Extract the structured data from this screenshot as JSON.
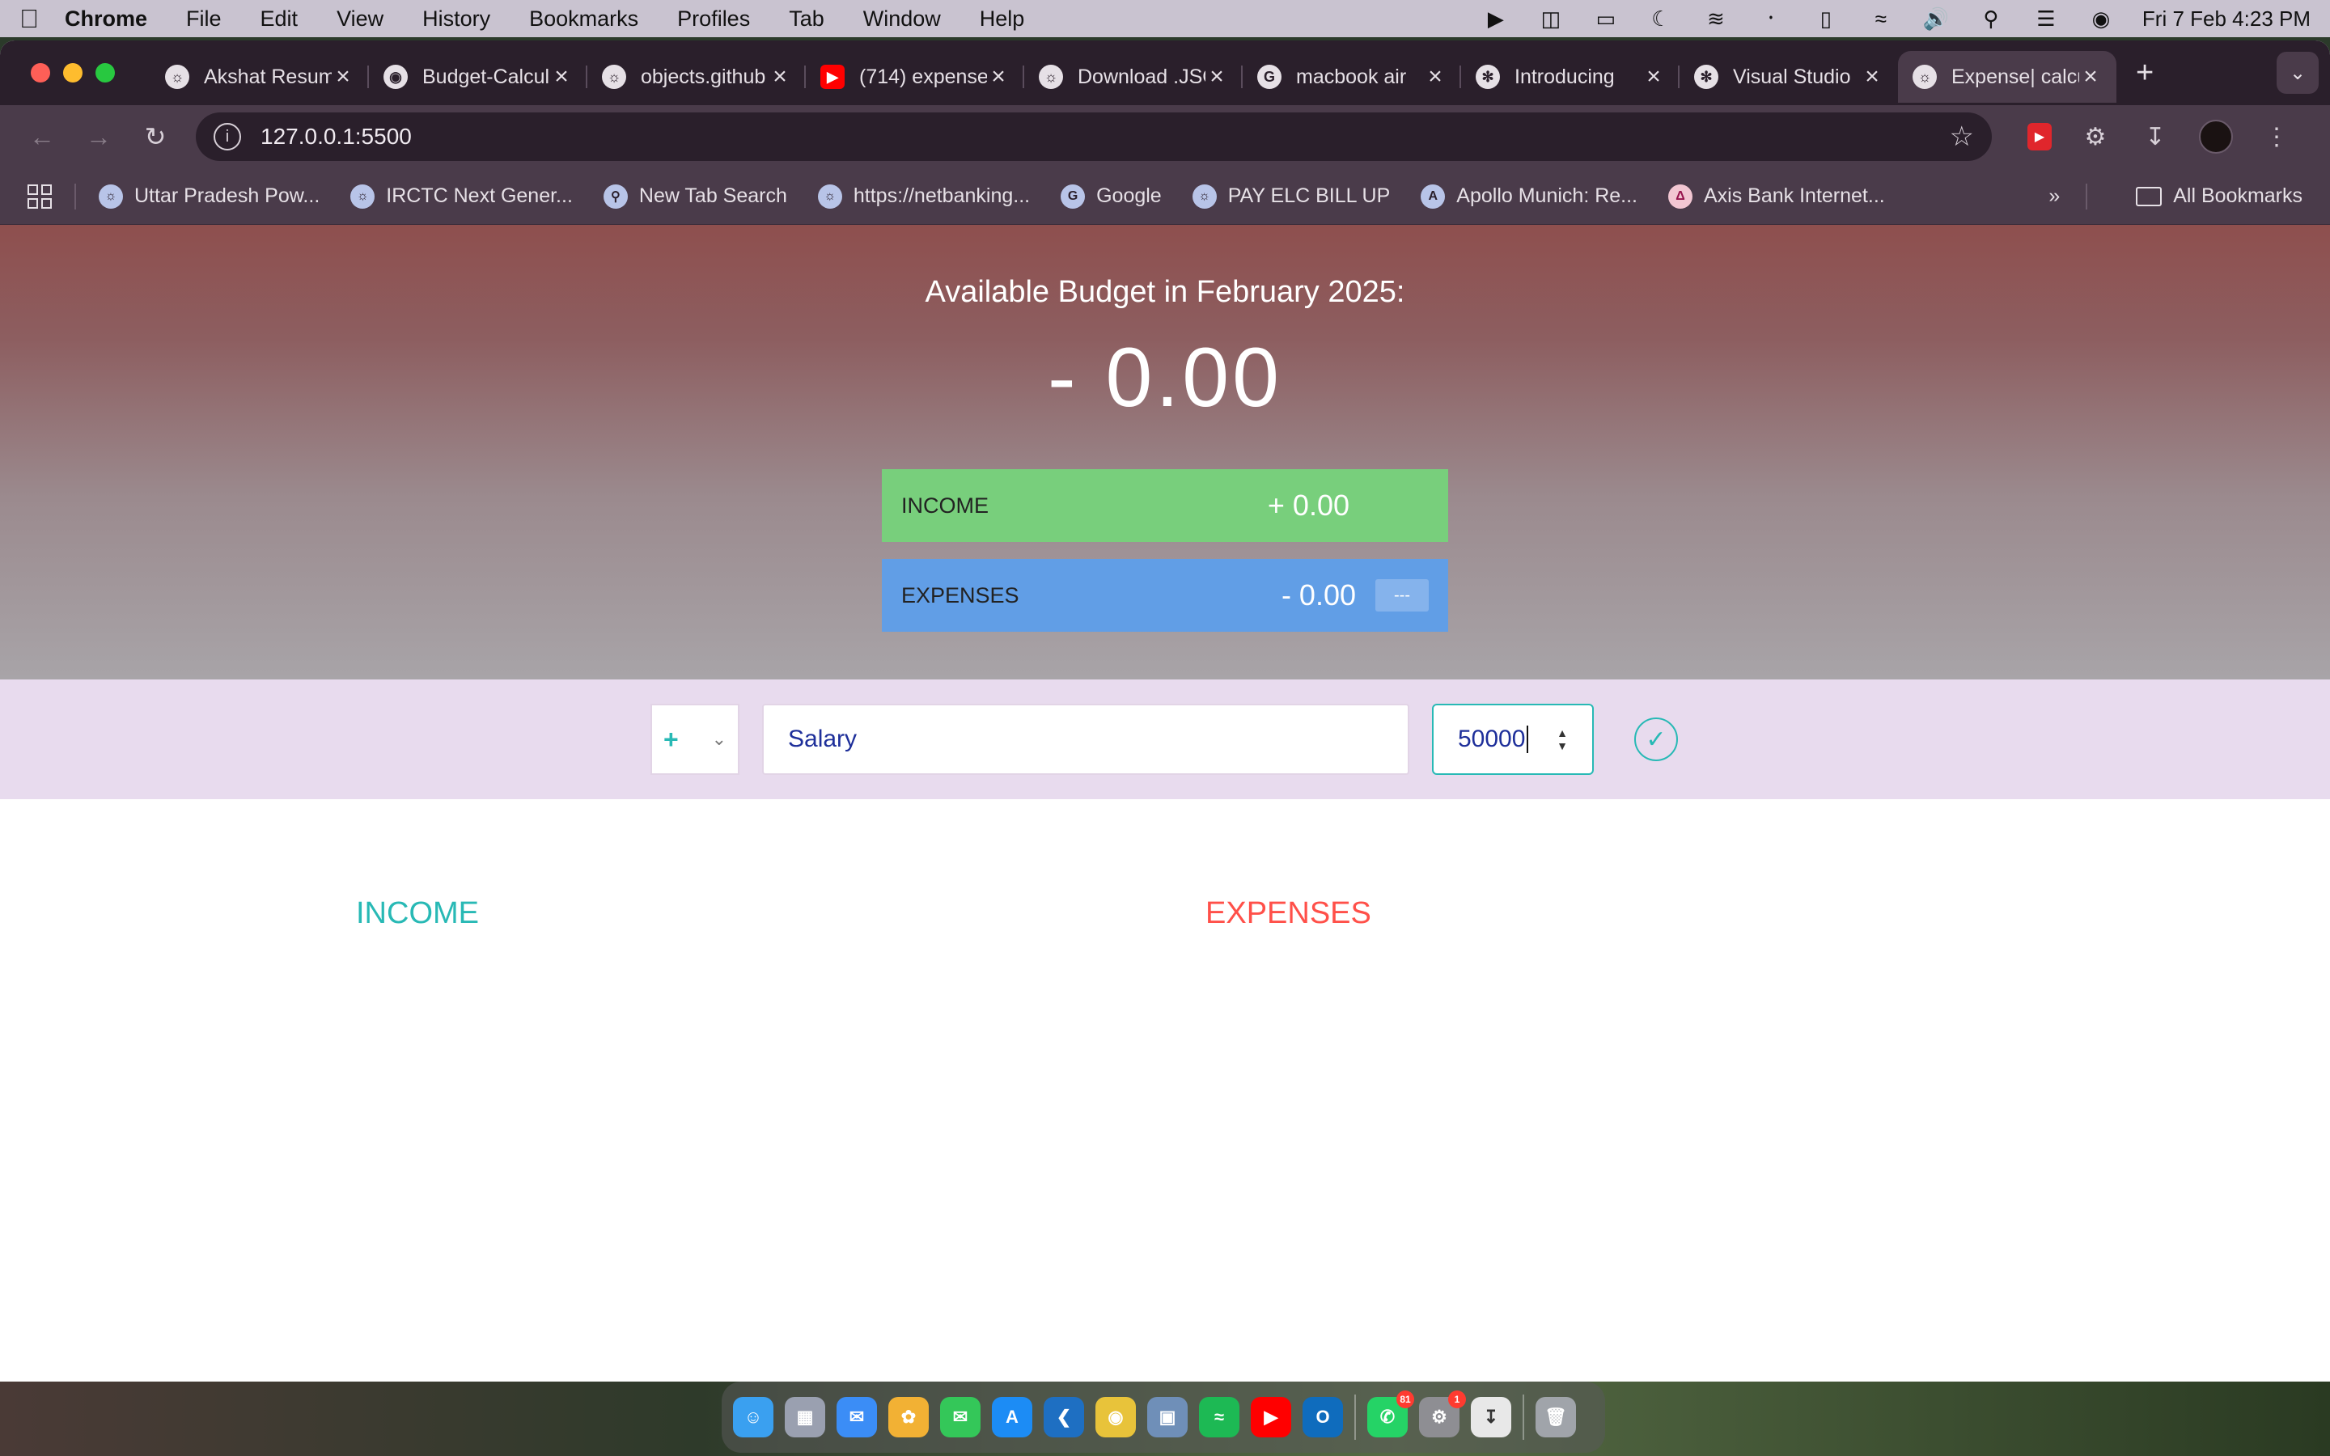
{
  "menubar": {
    "app_name": "Chrome",
    "items": [
      "File",
      "Edit",
      "View",
      "History",
      "Bookmarks",
      "Profiles",
      "Tab",
      "Window",
      "Help"
    ],
    "datetime": "Fri 7 Feb  4:23 PM"
  },
  "tabs": [
    {
      "title": "Akshat Resume",
      "icon": "globe-icon"
    },
    {
      "title": "Budget-Calculator",
      "icon": "github-icon"
    },
    {
      "title": "objects.github",
      "icon": "globe-icon"
    },
    {
      "title": "(714) expense",
      "icon": "youtube-icon"
    },
    {
      "title": "Download .JSON",
      "icon": "globe-icon"
    },
    {
      "title": "macbook air",
      "icon": "google-icon"
    },
    {
      "title": "Introducing",
      "icon": "openai-icon"
    },
    {
      "title": "Visual Studio",
      "icon": "openai-icon"
    },
    {
      "title": "Expense| calculator",
      "icon": "globe-icon",
      "active": true
    }
  ],
  "toolbar": {
    "url": "127.0.0.1:5500"
  },
  "bookmarks": {
    "items": [
      "Uttar Pradesh Pow...",
      "IRCTC Next Gener...",
      "New Tab Search",
      "https://netbanking...",
      "Google",
      "PAY ELC BILL UP",
      "Apollo Munich: Re...",
      "Axis Bank Internet..."
    ],
    "all_label": "All Bookmarks"
  },
  "budget": {
    "title": "Available Budget in February 2025:",
    "value": "- 0.00",
    "income_label": "Income",
    "income_value": "+ 0.00",
    "expenses_label": "Expenses",
    "expenses_value": "- 0.00",
    "expenses_percentage": "---"
  },
  "add": {
    "type": "+",
    "description": "Salary",
    "amount": "50000"
  },
  "lists": {
    "income_title": "Income",
    "expenses_title": "Expenses"
  },
  "dock": {
    "whatsapp_badge": "81",
    "settings_badge": "1"
  },
  "colors": {
    "income_green": "#78cf7c",
    "expenses_blue": "#619ee6",
    "accent_teal": "#28b9b5",
    "expense_red": "#ff5049"
  }
}
